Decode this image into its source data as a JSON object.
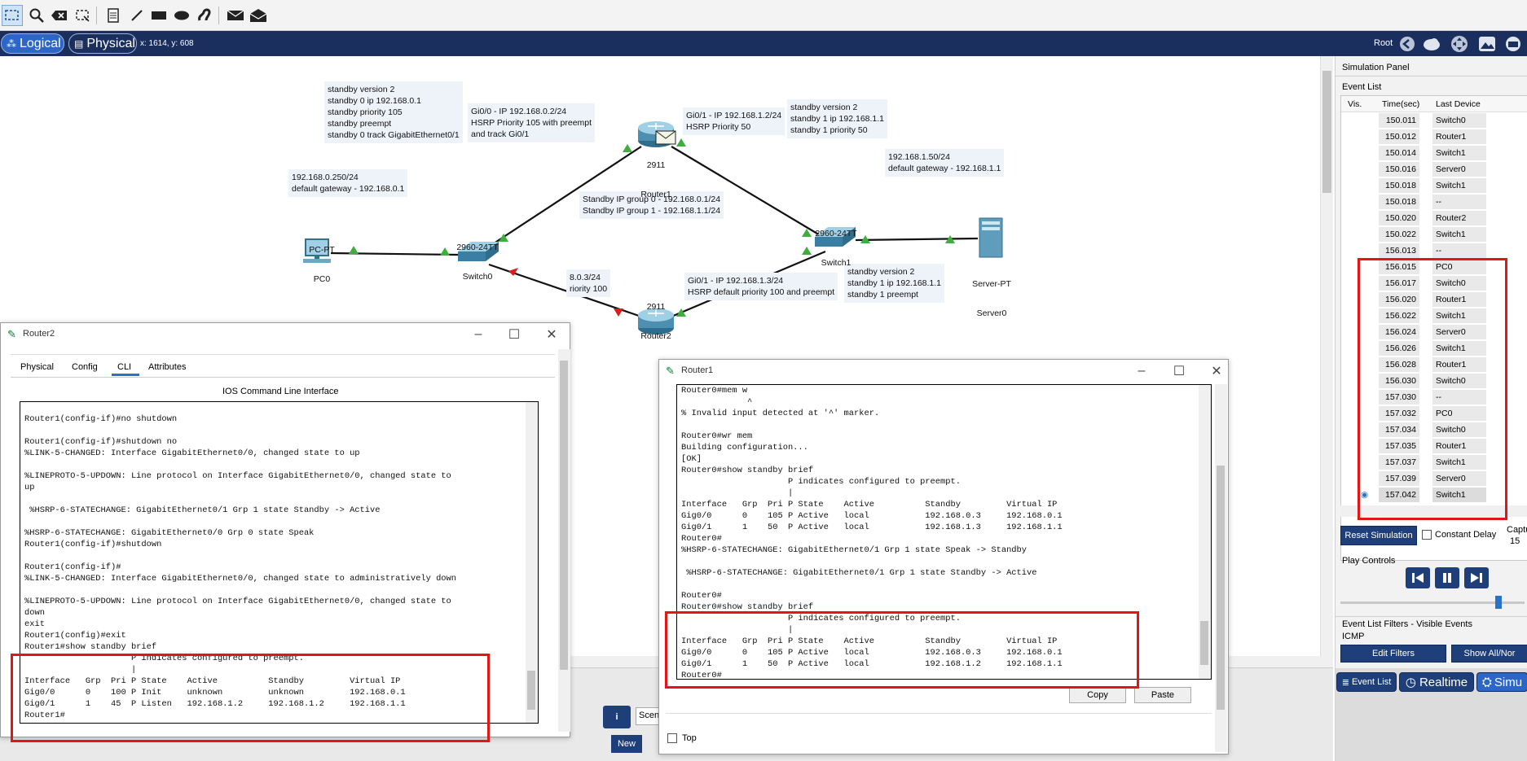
{
  "toolbar": {
    "tools": [
      "select-icon",
      "zoom-icon",
      "delete-icon",
      "resize-icon",
      "note-icon",
      "line-icon",
      "rectangle-icon",
      "ellipse-icon",
      "freeform-icon",
      "simple-pdu-icon",
      "complex-pdu-icon"
    ]
  },
  "viewbar": {
    "logical_label": "Logical",
    "physical_label": "Physical",
    "coords": "x: 1614, y: 608",
    "root_label": "Root"
  },
  "topology": {
    "notes": {
      "router1_config": "standby version 2\nstandby 0 ip 192.168.0.1\nstandby priority 105\nstandby preempt\nstandby 0 track GigabitEthernet0/1",
      "router1_gi00": "Gi0/0 - IP 192.168.0.2/24\nHSRP Priority 105 with preempt\nand track Gi0/1",
      "router1_gi01": "Gi0/1 - IP 192.168.1.2/24\nHSRP Priority 50",
      "router1_group1": "standby version 2\nstandby 1 ip 192.168.1.1\nstandby 1 priority 50",
      "server_ip": "192.168.1.50/24\ndefault gateway - 192.168.1.1",
      "pc_ip": "192.168.0.250/24\ndefault gateway - 192.168.0.1",
      "groups": "Standby IP group 0 - 192.168.0.1/24\nStandby IP group 1 - 192.168.1.1/24",
      "router2_partial": "8.0.3/24\nriority 100",
      "router2_gi01": "Gi0/1 - IP 192.168.1.3/24\nHSRP default priority 100 and preempt",
      "router2_config": "standby version 2\nstandby 1 ip 192.168.1.1\nstandby 1 preempt"
    },
    "devices": {
      "router1": {
        "model": "2911",
        "name": "Router1"
      },
      "router2": {
        "model": "2911",
        "name": "Router2"
      },
      "switch0": {
        "model": "2960-24TT",
        "name": "Switch0"
      },
      "switch1": {
        "model": "2960-24TT",
        "name": "Switch1"
      },
      "pc0": {
        "model": "PC-PT",
        "name": "PC0"
      },
      "server0": {
        "model": "Server-PT",
        "name": "Server0"
      }
    }
  },
  "router2_window": {
    "title": "Router2",
    "tabs": [
      "Physical",
      "Config",
      "CLI",
      "Attributes"
    ],
    "active_tab": "CLI",
    "panel_title": "IOS Command Line Interface",
    "cli_text": "% Invalid input detected at '^' marker.\n\nRouter1(config-if)#no shutdown\n\nRouter1(config-if)#shutdown no\n%LINK-5-CHANGED: Interface GigabitEthernet0/0, changed state to up\n\n%LINEPROTO-5-UPDOWN: Line protocol on Interface GigabitEthernet0/0, changed state to\nup\n\n %HSRP-6-STATECHANGE: GigabitEthernet0/1 Grp 1 state Standby -> Active\n\n%HSRP-6-STATECHANGE: GigabitEthernet0/0 Grp 0 state Speak\nRouter1(config-if)#shutdown\n\nRouter1(config-if)#\n%LINK-5-CHANGED: Interface GigabitEthernet0/0, changed state to administratively down\n\n%LINEPROTO-5-UPDOWN: Line protocol on Interface GigabitEthernet0/0, changed state to\ndown\nexit\nRouter1(config)#exit\nRouter1#show standby brief\n                     P indicates configured to preempt.\n                     |\nInterface   Grp  Pri P State    Active          Standby         Virtual IP\nGig0/0      0    100 P Init     unknown         unknown         192.168.0.1\nGig0/1      1    45  P Listen   192.168.1.2     192.168.1.2     192.168.1.1\nRouter1#"
  },
  "router1_window": {
    "title": "Router1",
    "cli_text": "Router0#mem w\n             ^\n% Invalid input detected at '^' marker.\n\nRouter0#wr mem\nBuilding configuration...\n[OK]\nRouter0#show standby brief\n                     P indicates configured to preempt.\n                     |\nInterface   Grp  Pri P State    Active          Standby         Virtual IP\nGig0/0      0    105 P Active   local           192.168.0.3     192.168.0.1\nGig0/1      1    50  P Active   local           192.168.1.3     192.168.1.1\nRouter0#\n%HSRP-6-STATECHANGE: GigabitEthernet0/1 Grp 1 state Speak -> Standby\n\n %HSRP-6-STATECHANGE: GigabitEthernet0/1 Grp 1 state Standby -> Active\n\nRouter0#\nRouter0#show standby brief\n                     P indicates configured to preempt.\n                     |\nInterface   Grp  Pri P State    Active          Standby         Virtual IP\nGig0/0      0    105 P Active   local           192.168.0.3     192.168.0.1\nGig0/1      1    50  P Active   local           192.168.1.2     192.168.1.1\nRouter0#",
    "copy_label": "Copy",
    "paste_label": "Paste",
    "top_label": "Top"
  },
  "bottom_strip": {
    "new_label": "New",
    "scenario_partial": "Scen"
  },
  "sim_panel": {
    "title": "Simulation Panel",
    "event_list_title": "Event List",
    "columns": {
      "vis": "Vis.",
      "time": "Time(sec)",
      "device": "Last Device"
    },
    "events": [
      {
        "time": "150.011",
        "device": "Switch0"
      },
      {
        "time": "150.012",
        "device": "Router1"
      },
      {
        "time": "150.014",
        "device": "Switch1"
      },
      {
        "time": "150.016",
        "device": "Server0"
      },
      {
        "time": "150.018",
        "device": "Switch1"
      },
      {
        "time": "150.018",
        "device": "--"
      },
      {
        "time": "150.020",
        "device": "Router2"
      },
      {
        "time": "150.022",
        "device": "Switch1"
      },
      {
        "time": "156.013",
        "device": "--"
      },
      {
        "time": "156.015",
        "device": "PC0"
      },
      {
        "time": "156.017",
        "device": "Switch0"
      },
      {
        "time": "156.020",
        "device": "Router1"
      },
      {
        "time": "156.022",
        "device": "Switch1"
      },
      {
        "time": "156.024",
        "device": "Server0"
      },
      {
        "time": "156.026",
        "device": "Switch1"
      },
      {
        "time": "156.028",
        "device": "Router1"
      },
      {
        "time": "156.030",
        "device": "Switch0"
      },
      {
        "time": "157.030",
        "device": "--"
      },
      {
        "time": "157.032",
        "device": "PC0"
      },
      {
        "time": "157.034",
        "device": "Switch0"
      },
      {
        "time": "157.035",
        "device": "Router1"
      },
      {
        "time": "157.037",
        "device": "Switch1"
      },
      {
        "time": "157.039",
        "device": "Server0"
      },
      {
        "time": "157.042",
        "device": "Switch1"
      }
    ],
    "reset_label": "Reset Simulation",
    "constant_delay_label": "Constant Delay",
    "capture_label": "Captu",
    "capture_value": "15",
    "play_controls_label": "Play Controls",
    "filters_title": "Event List Filters - Visible Events",
    "filter_value": "ICMP",
    "edit_filters_label": "Edit Filters",
    "show_all_label": "Show All/Nor",
    "mode_event_list": "Event List",
    "mode_realtime": "Realtime",
    "mode_simulation": "Simu"
  },
  "colors": {
    "navy": "#1b2f5e",
    "accent_blue": "#2c67c8",
    "highlight_red": "#e21616",
    "link_green": "#3fae3f"
  }
}
